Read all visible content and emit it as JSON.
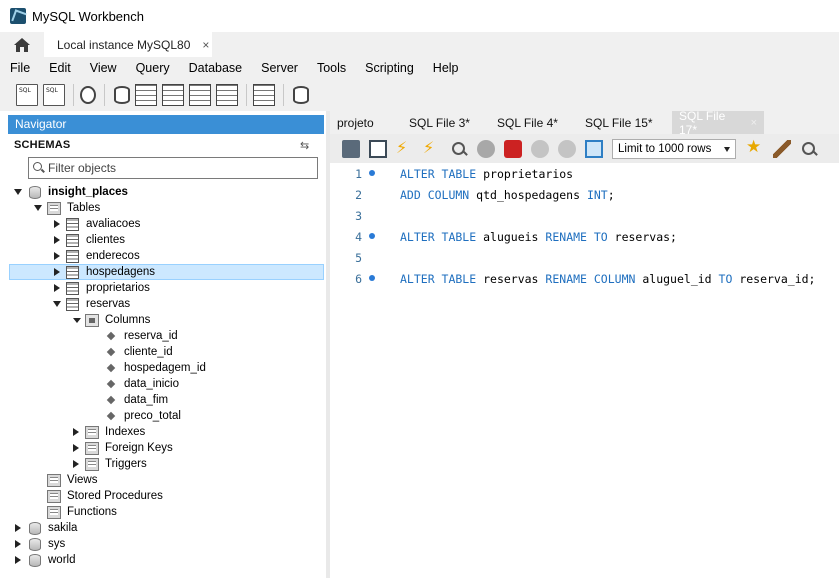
{
  "app": {
    "title": "MySQL Workbench"
  },
  "connection_tab": {
    "label": "Local instance MySQL80",
    "close": "×"
  },
  "menu": [
    "File",
    "Edit",
    "View",
    "Query",
    "Database",
    "Server",
    "Tools",
    "Scripting",
    "Help"
  ],
  "toolbar_icons": [
    "new-sql-tab-icon",
    "open-sql-script-icon",
    "inspector-icon",
    "create-schema-icon",
    "create-table-icon",
    "create-view-icon",
    "create-procedure-icon",
    "create-function-icon",
    "search-table-data-icon",
    "reconnect-icon"
  ],
  "navigator": {
    "title": "Navigator",
    "schemas_label": "SCHEMAS",
    "filter_placeholder": "Filter objects",
    "tree": {
      "schema": "insight_places",
      "tables_label": "Tables",
      "tables": [
        "avaliacoes",
        "clientes",
        "enderecos",
        "hospedagens",
        "proprietarios",
        "reservas"
      ],
      "selected_table": "hospedagens",
      "columns_label": "Columns",
      "columns": [
        "reserva_id",
        "cliente_id",
        "hospedagem_id",
        "data_inicio",
        "data_fim",
        "preco_total"
      ],
      "indexes_label": "Indexes",
      "foreign_keys_label": "Foreign Keys",
      "triggers_label": "Triggers",
      "views_label": "Views",
      "stored_procedures_label": "Stored Procedures",
      "functions_label": "Functions",
      "other_schemas": [
        "sakila",
        "sys",
        "world"
      ]
    }
  },
  "editor": {
    "tabs": [
      {
        "label": "projeto",
        "active": false
      },
      {
        "label": "SQL File 3*",
        "active": false
      },
      {
        "label": "SQL File 4*",
        "active": false
      },
      {
        "label": "SQL File 15*",
        "active": false
      },
      {
        "label": "SQL File 17*",
        "active": true,
        "close": "×"
      }
    ],
    "limit_rows": "Limit to 1000 rows",
    "lines": [
      {
        "n": "1",
        "marker": true,
        "parts": [
          [
            "ALTER TABLE",
            "kw"
          ],
          [
            " proprietarios",
            ""
          ]
        ]
      },
      {
        "n": "2",
        "marker": false,
        "parts": [
          [
            "ADD COLUMN",
            "kw"
          ],
          [
            " qtd_hospedagens ",
            ""
          ],
          [
            "INT",
            "kw"
          ],
          [
            ";",
            ""
          ]
        ]
      },
      {
        "n": "3",
        "marker": false,
        "parts": []
      },
      {
        "n": "4",
        "marker": true,
        "parts": [
          [
            "ALTER TABLE",
            "kw"
          ],
          [
            " alugueis ",
            ""
          ],
          [
            "RENAME TO",
            "kw"
          ],
          [
            " reservas;",
            ""
          ]
        ]
      },
      {
        "n": "5",
        "marker": false,
        "parts": []
      },
      {
        "n": "6",
        "marker": true,
        "parts": [
          [
            "ALTER TABLE",
            "kw"
          ],
          [
            " reservas ",
            ""
          ],
          [
            "RENAME COLUMN",
            "kw"
          ],
          [
            " aluguel_id ",
            ""
          ],
          [
            "TO",
            "kw"
          ],
          [
            " reserva_id;",
            ""
          ]
        ]
      }
    ]
  }
}
